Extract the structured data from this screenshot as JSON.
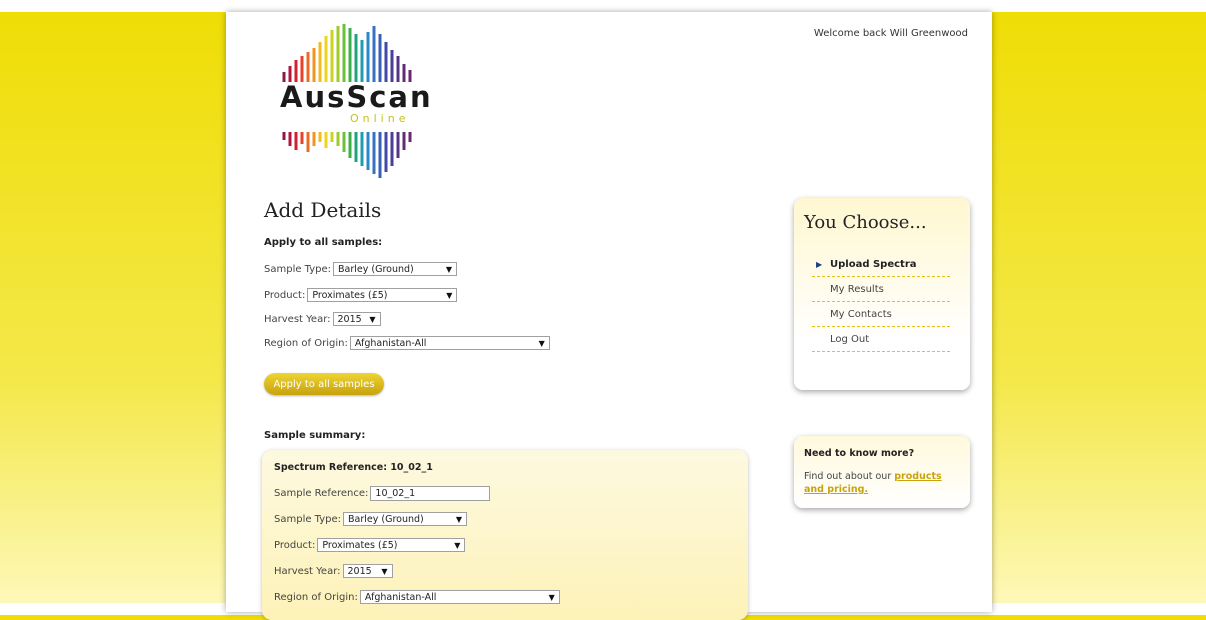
{
  "header": {
    "welcome": "Welcome back Will Greenwood"
  },
  "logo": {
    "name": "AusScan",
    "sub": "Online"
  },
  "page_title": "Add Details",
  "apply_all": {
    "title": "Apply to all samples:",
    "sample_type": {
      "label": "Sample Type:",
      "value": "Barley (Ground)"
    },
    "product": {
      "label": "Product:",
      "value": "Proximates (£5)"
    },
    "harvest_year": {
      "label": "Harvest Year:",
      "value": "2015"
    },
    "region": {
      "label": "Region of Origin:",
      "value": "Afghanistan-All"
    },
    "button": "Apply to all samples"
  },
  "summary": {
    "title": "Sample summary:",
    "spectrum_ref": "Spectrum Reference: 10_02_1",
    "sample_ref": {
      "label": "Sample Reference:",
      "value": "10_02_1"
    },
    "sample_type": {
      "label": "Sample Type:",
      "value": "Barley (Ground)"
    },
    "product": {
      "label": "Product:",
      "value": "Proximates (£5)"
    },
    "harvest_year": {
      "label": "Harvest Year:",
      "value": "2015"
    },
    "region": {
      "label": "Region of Origin:",
      "value": "Afghanistan-All"
    }
  },
  "side_panel": {
    "title": "You Choose...",
    "items": [
      {
        "label": "Upload Spectra",
        "active": true
      },
      {
        "label": "My Results"
      },
      {
        "label": "My Contacts"
      },
      {
        "label": "Log Out"
      }
    ]
  },
  "info_box": {
    "title": "Need to know more?",
    "text": "Find out about our ",
    "link": "products and pricing."
  },
  "colors": {
    "accent": "#efdd05",
    "button": "#d4b014",
    "link": "#c9a308"
  }
}
